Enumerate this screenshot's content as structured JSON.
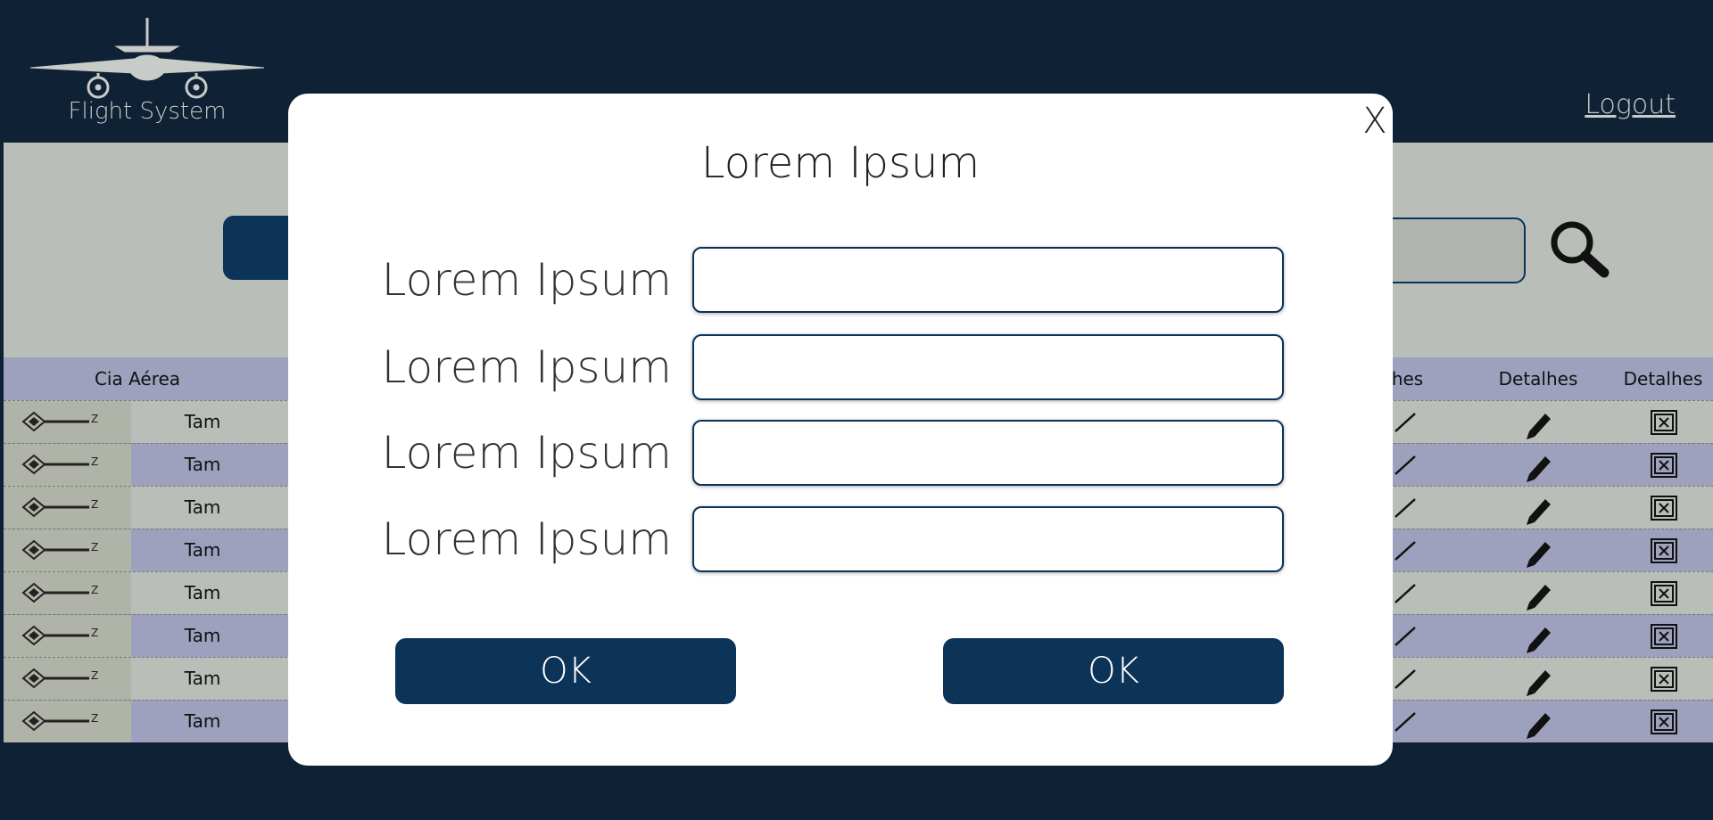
{
  "header": {
    "app_name": "Flight System",
    "logout_label": "Logout"
  },
  "table": {
    "headers": {
      "airline": "Cia Aérea",
      "details_partial": "alhes",
      "details_edit": "Detalhes",
      "details_delete": "Detalhes"
    },
    "rows": [
      {
        "airline": "Tam"
      },
      {
        "airline": "Tam"
      },
      {
        "airline": "Tam"
      },
      {
        "airline": "Tam"
      },
      {
        "airline": "Tam"
      },
      {
        "airline": "Tam"
      },
      {
        "airline": "Tam"
      },
      {
        "airline": "Tam"
      }
    ]
  },
  "modal": {
    "close_label": "X",
    "title": "Lorem Ipsum",
    "fields": [
      {
        "label": "Lorem Ipsum",
        "value": ""
      },
      {
        "label": "Lorem Ipsum",
        "value": ""
      },
      {
        "label": "Lorem Ipsum",
        "value": ""
      },
      {
        "label": "Lorem Ipsum",
        "value": ""
      }
    ],
    "buttons": {
      "left": "OK",
      "right": "OK"
    }
  },
  "colors": {
    "navy": "#0f2135",
    "button_blue": "#0c3358",
    "content_gray": "#b9bfb8",
    "row_lavender": "#9ea1bd"
  }
}
